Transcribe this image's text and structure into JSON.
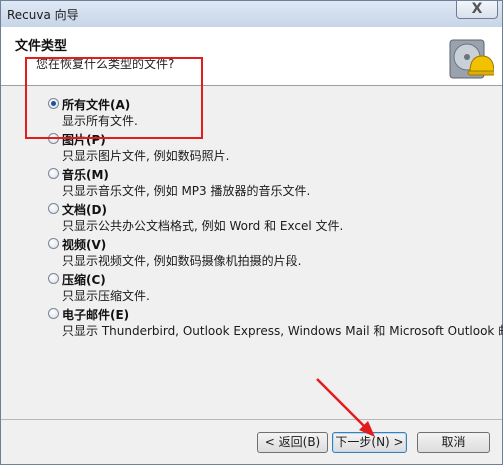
{
  "window": {
    "title": "Recuva 向导",
    "close_label": "X"
  },
  "header": {
    "title": "文件类型",
    "subtitle": "您在恢复什么类型的文件?"
  },
  "options": [
    {
      "label": "所有文件(A)",
      "desc": "显示所有文件.",
      "checked": true
    },
    {
      "label": "图片(P)",
      "desc": "只显示图片文件, 例如数码照片.",
      "checked": false
    },
    {
      "label": "音乐(M)",
      "desc": "只显示音乐文件, 例如 MP3 播放器的音乐文件.",
      "checked": false
    },
    {
      "label": "文档(D)",
      "desc": "只显示公共办公文档格式, 例如 Word 和 Excel 文件.",
      "checked": false
    },
    {
      "label": "视频(V)",
      "desc": "只显示视频文件, 例如数码摄像机拍摄的片段.",
      "checked": false
    },
    {
      "label": "压缩(C)",
      "desc": "只显示压缩文件.",
      "checked": false
    },
    {
      "label": "电子邮件(E)",
      "desc": "只显示 Thunderbird, Outlook Express, Windows Mail 和 Microsoft Outlook 邮件.",
      "checked": false
    }
  ],
  "buttons": {
    "back": "< 返回(B)",
    "next": "下一步(N) >",
    "cancel": "取消"
  },
  "colors": {
    "annotation_red": "#e21d1d",
    "radio_dot": "#1e4fa3"
  },
  "icons": {
    "header": "hard-drive-hardhat-icon"
  }
}
